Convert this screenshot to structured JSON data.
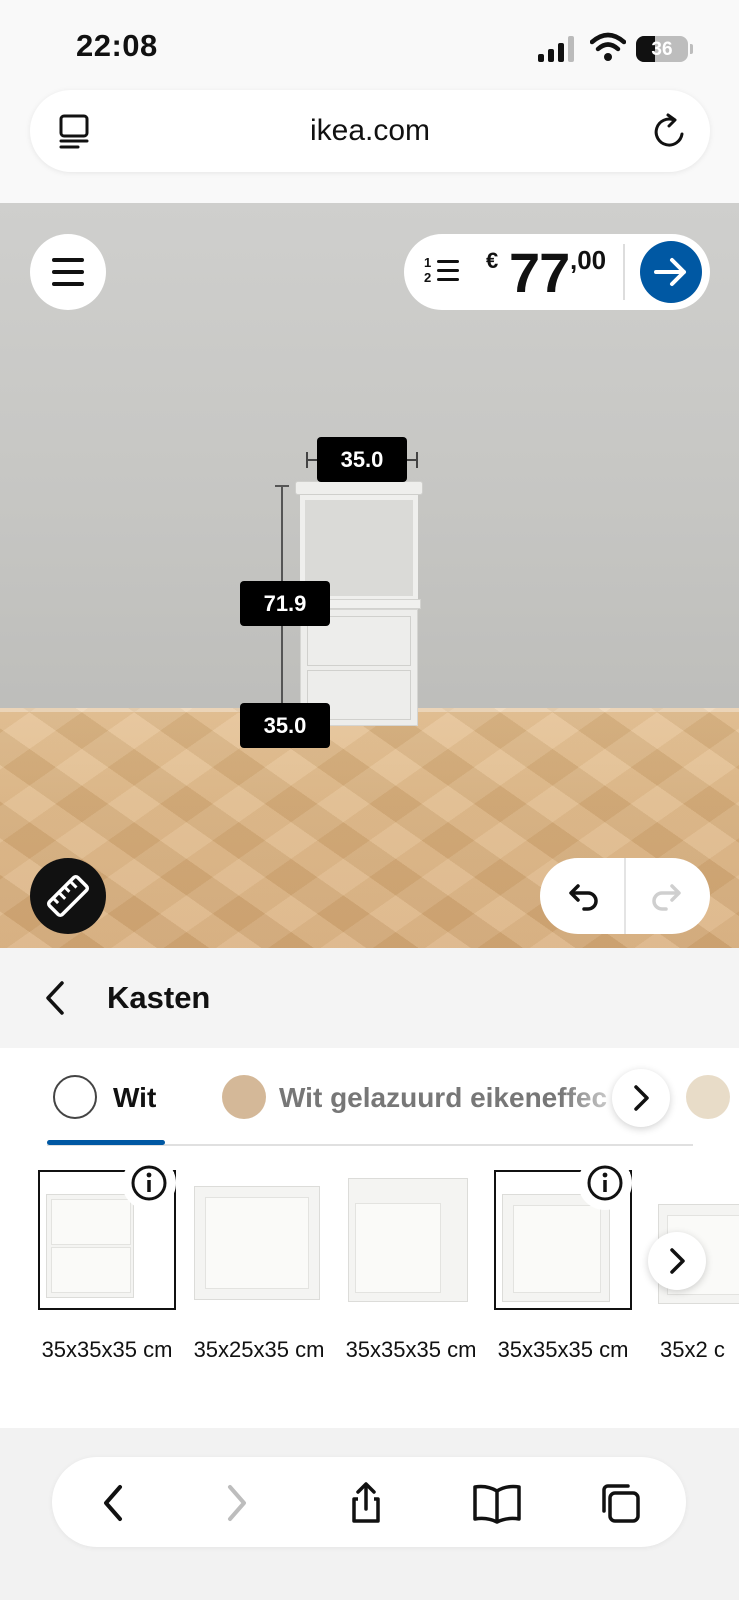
{
  "status_bar": {
    "time": "22:08",
    "battery": "36"
  },
  "browser": {
    "url": "ikea.com"
  },
  "planner": {
    "price": {
      "currency": "€",
      "integer": "77",
      "decimal": ",00"
    },
    "dimensions": {
      "width": "35.0",
      "height": "71.9",
      "depth": "35.0"
    }
  },
  "category": {
    "title": "Kasten"
  },
  "color_tabs": [
    {
      "label": "Wit",
      "color": "#ffffff",
      "active": true
    },
    {
      "label": "Wit gelazuurd eikeneffec",
      "color": "#d4b898",
      "active": false
    }
  ],
  "products": [
    {
      "label": "35x35x35 cm",
      "selected": true,
      "info": true
    },
    {
      "label": "35x25x35 cm",
      "selected": false,
      "info": false
    },
    {
      "label": "35x35x35 cm",
      "selected": false,
      "info": false
    },
    {
      "label": "35x35x35 cm",
      "selected": true,
      "info": true
    },
    {
      "label": "35x2 c",
      "selected": false,
      "info": false
    }
  ],
  "icons": {
    "reader": "reader-mode-icon",
    "reload": "reload-icon",
    "menu": "hamburger-menu-icon",
    "list": "numbered-list-icon",
    "go": "arrow-right-icon",
    "measure": "ruler-icon",
    "undo": "undo-icon",
    "redo": "redo-icon",
    "back": "chevron-left-icon",
    "info": "info-icon",
    "nav_back": "chevron-left-icon",
    "nav_forward": "chevron-right-icon",
    "share": "share-icon",
    "bookmarks": "book-icon",
    "tabs": "tabs-icon"
  },
  "colors": {
    "accent": "#0058a3",
    "floor": "#ddb583",
    "wall": "#c8c8c5"
  }
}
